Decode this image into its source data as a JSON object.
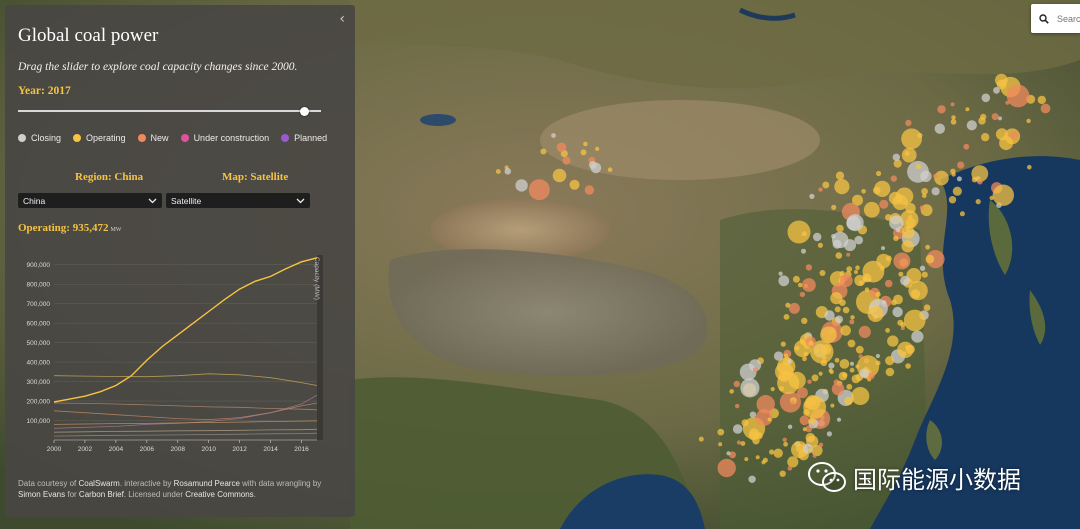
{
  "panel": {
    "collapse_glyph": "‹",
    "title": "Global coal power",
    "subtitle": "Drag the slider to explore coal capacity changes since 2000.",
    "year_label": "Year: 2017",
    "slider": {
      "min": 2000,
      "max": 2017,
      "value": 2017
    },
    "legend": [
      {
        "label": "Closing",
        "color": "#cfcfcf"
      },
      {
        "label": "Operating",
        "color": "#f6c343"
      },
      {
        "label": "New",
        "color": "#f08a5d"
      },
      {
        "label": "Under construction",
        "color": "#e0529c"
      },
      {
        "label": "Planned",
        "color": "#9b59d0"
      }
    ],
    "region_label": "Region: China",
    "map_label": "Map: Satellite",
    "region_select": {
      "value": "China"
    },
    "map_select": {
      "value": "Satellite"
    },
    "operating_label": "Operating: 935,472",
    "operating_unit": "MW",
    "footer": {
      "t1": "Data courtesy of ",
      "l1": "CoalSwarm",
      "t2": ". interactive by ",
      "l2": "Rosamund Pearce",
      "t3": " with data wrangling by ",
      "l3": "Simon Evans",
      "t4": " for ",
      "l4": "Carbon Brief",
      "t5": ". Licensed under ",
      "l5": "Creative Commons",
      "t6": "."
    }
  },
  "search": {
    "placeholder": "Search"
  },
  "watermark": {
    "text": "国际能源小数据"
  },
  "colors": {
    "accent": "#f6c343",
    "operating": "#f6c343",
    "new": "#f08a5d",
    "closing": "#cfcfcf",
    "construction": "#e0529c",
    "planned": "#9b59d0"
  },
  "chart_data": {
    "type": "line",
    "ylabel": "Capacity (MW)",
    "xlim": [
      2000,
      2017
    ],
    "ylim": [
      0,
      950000
    ],
    "x_ticks": [
      "2000",
      "2002",
      "2004",
      "2006",
      "2008",
      "2010",
      "2012",
      "2014",
      "2016"
    ],
    "y_ticks": [
      "100,000",
      "200,000",
      "300,000",
      "400,000",
      "500,000",
      "600,000",
      "700,000",
      "800,000",
      "900,000"
    ],
    "series": [
      {
        "color": "#f6c343",
        "width": 1.4,
        "x": [
          2000,
          2001,
          2002,
          2003,
          2004,
          2005,
          2006,
          2007,
          2008,
          2009,
          2010,
          2011,
          2012,
          2013,
          2014,
          2015,
          2016,
          2017
        ],
        "y": [
          195000,
          210000,
          225000,
          248000,
          280000,
          330000,
          410000,
          480000,
          540000,
          600000,
          660000,
          720000,
          775000,
          815000,
          840000,
          880000,
          915000,
          935472
        ]
      },
      {
        "color": "#cfae5a",
        "width": 0.8,
        "x": [
          2000,
          2002,
          2004,
          2006,
          2008,
          2010,
          2012,
          2014,
          2016,
          2017
        ],
        "y": [
          330000,
          328000,
          326000,
          325000,
          330000,
          340000,
          335000,
          320000,
          295000,
          280000
        ]
      },
      {
        "color": "#b98c6e",
        "width": 0.8,
        "x": [
          2000,
          2002,
          2004,
          2006,
          2008,
          2010,
          2012,
          2014,
          2016,
          2017
        ],
        "y": [
          190000,
          188000,
          185000,
          180000,
          175000,
          170000,
          168000,
          162000,
          158000,
          155000
        ]
      },
      {
        "color": "#c98a6a",
        "width": 0.8,
        "x": [
          2000,
          2002,
          2004,
          2006,
          2008,
          2010,
          2012,
          2014,
          2016,
          2017
        ],
        "y": [
          150000,
          140000,
          130000,
          120000,
          110000,
          105000,
          115000,
          140000,
          175000,
          190000
        ]
      },
      {
        "color": "#a67c9c",
        "width": 0.8,
        "x": [
          2000,
          2002,
          2004,
          2006,
          2008,
          2010,
          2012,
          2014,
          2016,
          2017
        ],
        "y": [
          60000,
          65000,
          70000,
          80000,
          85000,
          95000,
          110000,
          140000,
          185000,
          230000
        ]
      },
      {
        "color": "#d09a5e",
        "width": 0.8,
        "x": [
          2000,
          2002,
          2004,
          2006,
          2008,
          2010,
          2012,
          2014,
          2016,
          2017
        ],
        "y": [
          80000,
          82000,
          84000,
          85000,
          88000,
          90000,
          92000,
          95000,
          97000,
          98000
        ]
      },
      {
        "color": "#b7a48a",
        "width": 0.8,
        "x": [
          2000,
          2002,
          2004,
          2006,
          2008,
          2010,
          2012,
          2014,
          2016,
          2017
        ],
        "y": [
          40000,
          42000,
          44000,
          45000,
          47000,
          48000,
          50000,
          52000,
          53000,
          55000
        ]
      },
      {
        "color": "#9a8f8a",
        "width": 0.8,
        "x": [
          2000,
          2002,
          2004,
          2006,
          2008,
          2010,
          2012,
          2014,
          2016,
          2017
        ],
        "y": [
          20000,
          22000,
          24000,
          25000,
          26000,
          28000,
          30000,
          32000,
          33000,
          35000
        ]
      }
    ]
  }
}
